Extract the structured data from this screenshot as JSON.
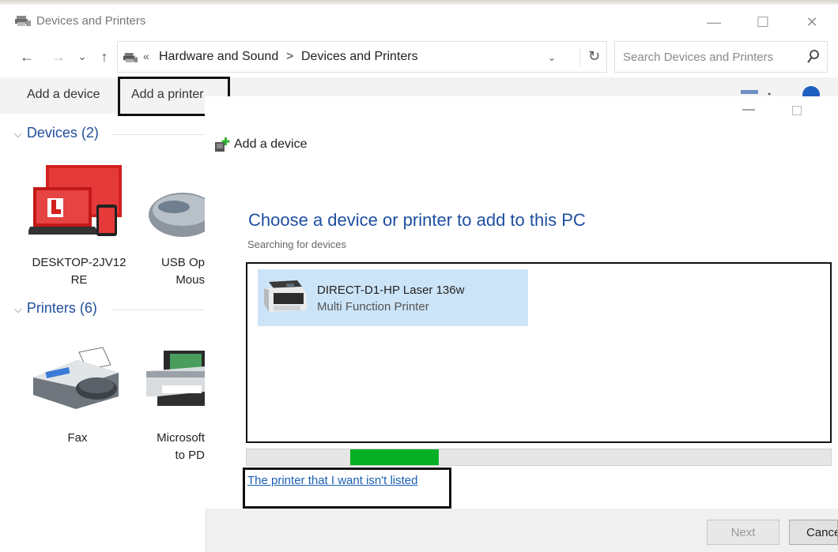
{
  "window": {
    "title": "Devices and Printers",
    "minimize_glyph": "—",
    "maximize_glyph": "☐",
    "close_glyph": "✕"
  },
  "nav": {
    "back_glyph": "←",
    "forward_glyph": "→",
    "recent_glyph": "⌄",
    "up_glyph": "↑",
    "address_chevron": "«",
    "breadcrumb": [
      "Hardware and Sound",
      "Devices and Printers"
    ],
    "breadcrumb_separator": ">",
    "dropdown_glyph": "⌄",
    "refresh_glyph": "↻",
    "search_placeholder": "Search Devices and Printers"
  },
  "commandbar": {
    "add_device": "Add a device",
    "add_printer": "Add a printer"
  },
  "groups": {
    "devices": {
      "title": "Devices (2)",
      "items": [
        {
          "label_line1": "DESKTOP-2JV12",
          "label_line2": "RE"
        },
        {
          "label_line1": "USB Op",
          "label_line2": "Mous"
        }
      ]
    },
    "printers": {
      "title": "Printers (6)",
      "items": [
        {
          "label_line1": "Fax",
          "label_line2": ""
        },
        {
          "label_line1": "Microsoft",
          "label_line2": "to PD"
        }
      ]
    }
  },
  "dialog": {
    "title": "Add a device",
    "heading": "Choose a device or printer to add to this PC",
    "status": "Searching for devices",
    "devices": [
      {
        "name": "DIRECT-D1-HP Laser 136w",
        "type": "Multi Function Printer"
      }
    ],
    "progress": {
      "start_fraction": 0.177,
      "width_fraction": 0.152
    },
    "not_listed_link": "The printer that I want isn't listed",
    "next_button": "Next",
    "cancel_button": "Cancel"
  },
  "colors": {
    "link": "#1a5fb4",
    "heading": "#1e4fa0",
    "selection": "#cce4f7",
    "progress": "#06b025",
    "highlight_box": "#111111"
  },
  "icons": {
    "title": "devices-printers-icon",
    "search": "search-icon",
    "add_device": "add-device-icon",
    "printer": "printer-icon",
    "fax": "fax-icon",
    "computer": "computer-icon",
    "mouse": "mouse-icon"
  }
}
